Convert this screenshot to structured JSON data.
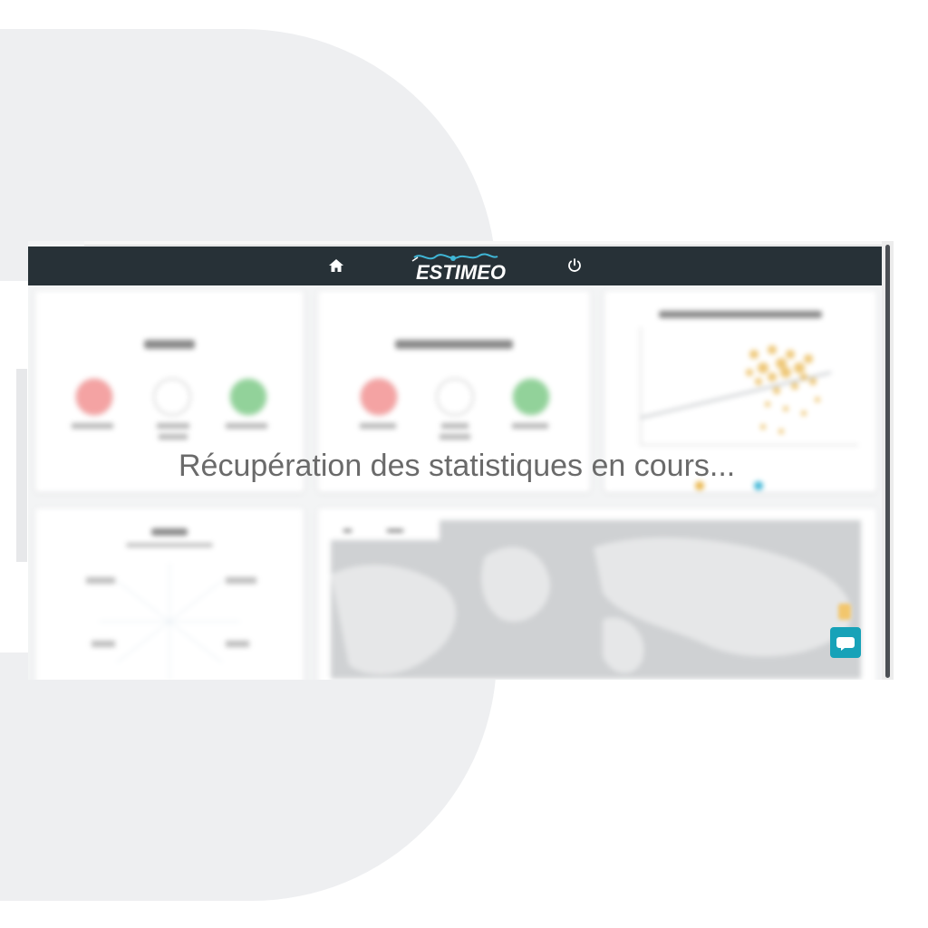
{
  "app": {
    "logo_text": "ESTIMEO"
  },
  "navbar": {
    "home_icon": "home-icon",
    "power_icon": "power-icon"
  },
  "loading": {
    "message": "Récupération des statistiques en cours..."
  },
  "colors": {
    "navbar": "#273137",
    "accent": "#17a2b8",
    "red": "#f4a3a3",
    "green": "#92d29a",
    "scatter": "#e9b54a"
  },
  "chat": {
    "icon": "chat-bubble-icon"
  }
}
